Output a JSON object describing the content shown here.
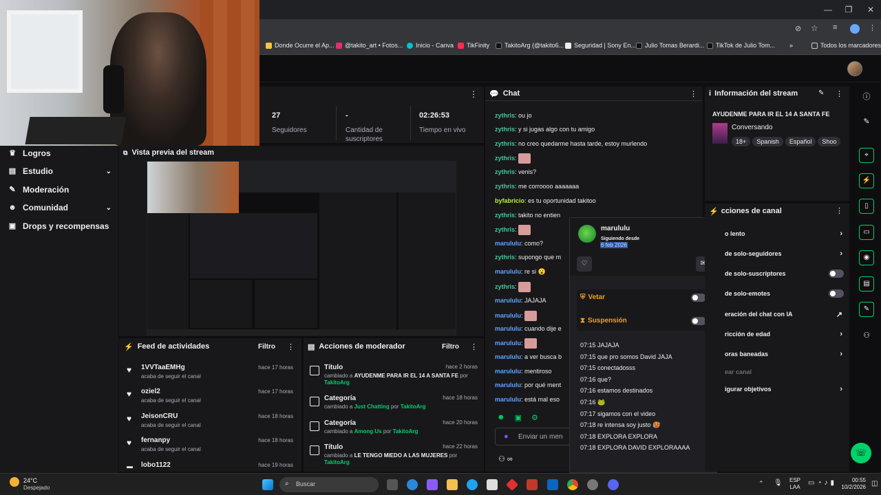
{
  "bookmarks": [
    {
      "label": "Donde Ocurre el Ap...",
      "color": "#f6c343"
    },
    {
      "label": "@takito_art • Fotos...",
      "color": "#e1306c"
    },
    {
      "label": "Inicio - Canva",
      "color": "#00c4cc"
    },
    {
      "label": "TikFinity",
      "color": "#fe2c55"
    },
    {
      "label": "TakitoArg (@takito6...",
      "color": "#000000"
    },
    {
      "label": "Seguridad | Sony En...",
      "color": "#ffffff"
    },
    {
      "label": "Julio Tomas Berardi...",
      "color": "#000000"
    },
    {
      "label": "TikTok de Julio Tom...",
      "color": "#000000"
    },
    {
      "label": "»",
      "color": ""
    },
    {
      "label": "Todos los marcadores",
      "color": ""
    }
  ],
  "leftnav": {
    "items": [
      {
        "label": "Logros",
        "icon": "trophy-icon"
      },
      {
        "label": "Estudio",
        "icon": "studio-icon"
      },
      {
        "label": "Moderación",
        "icon": "wrench-icon"
      },
      {
        "label": "Comunidad",
        "icon": "people-icon"
      },
      {
        "label": "Drops y recompensas",
        "icon": "gift-icon"
      }
    ]
  },
  "stats": {
    "followers_value": "27",
    "followers_label": "Seguidores",
    "subs_value": "-",
    "subs_label": "Cantidad de suscriptores",
    "live_value": "02:26:53",
    "live_label": "Tiempo en vivo"
  },
  "preview": {
    "title": "Vista previa del stream"
  },
  "feed": {
    "title": "Feed de actividades",
    "filter": "Filtro",
    "items": [
      {
        "name": "1VVTaaEMHg",
        "sub": "acaba de seguir el canal",
        "time": "hace 17 horas"
      },
      {
        "name": "oziel2",
        "sub": "acaba de seguir el canal",
        "time": "hace 17 horas"
      },
      {
        "name": "JeisonCRU",
        "sub": "acaba de seguir el canal",
        "time": "hace 18 horas"
      },
      {
        "name": "fernanpy",
        "sub": "acaba de seguir el canal",
        "time": "hace 18 horas"
      },
      {
        "name": "lobo1122",
        "sub": "",
        "time": "hace 19 horas"
      }
    ]
  },
  "modactions": {
    "title": "Acciones de moderador",
    "filter": "Filtro",
    "items": [
      {
        "title": "Título",
        "prefix": "cambiado a",
        "value": "AYUDENME PARA IR EL 14 A SANTA FE",
        "by": "por",
        "user": "TakitoArg",
        "time": "hace 2 horas"
      },
      {
        "title": "Categoría",
        "prefix": "cambiado a",
        "value": "Just Chatting",
        "by": "por",
        "user": "TakitoArg",
        "time": "hace 18 horas"
      },
      {
        "title": "Categoría",
        "prefix": "cambiado a",
        "value": "Among Us",
        "by": "por",
        "user": "TakitoArg",
        "time": "hace 20 horas"
      },
      {
        "title": "Título",
        "prefix": "cambiado a",
        "value": "LE TENGO MIEDO A LAS MUJERES",
        "by": "por",
        "user": "TakitoArg",
        "time": "hace 22 horas"
      }
    ]
  },
  "chat": {
    "title": "Chat",
    "placeholder": "Enviar un men",
    "messages": [
      {
        "user": "zythris",
        "text": "ou jo",
        "cls": "zy"
      },
      {
        "user": "zythris",
        "text": "y si jugas algo con tu amigo",
        "cls": "zy"
      },
      {
        "user": "zythris",
        "text": "no creo quedarme hasta tarde, estoy murlendo",
        "cls": "zy"
      },
      {
        "user": "zythris",
        "text": "",
        "cls": "zy",
        "emote": true
      },
      {
        "user": "zythris",
        "text": "venis?",
        "cls": "zy"
      },
      {
        "user": "zythris",
        "text": "me corroooo aaaaaaa",
        "cls": "zy"
      },
      {
        "user": "byfabricio",
        "text": "es tu oportunidad takitoo",
        "cls": "by"
      },
      {
        "user": "zythris",
        "text": "takito no entien",
        "cls": "zy"
      },
      {
        "user": "zythris",
        "text": "",
        "cls": "zy",
        "emote": true
      },
      {
        "user": "marululu",
        "text": "como?",
        "cls": "ma"
      },
      {
        "user": "zythris",
        "text": "supongo que m",
        "cls": "zy"
      },
      {
        "user": "marululu",
        "text": "re si 😮",
        "cls": "ma"
      },
      {
        "user": "zythris",
        "text": "",
        "cls": "zy",
        "emote": true
      },
      {
        "user": "marululu",
        "text": "JAJAJA",
        "cls": "ma"
      },
      {
        "user": "marululu",
        "text": "",
        "cls": "ma",
        "emote": true
      },
      {
        "user": "marululu",
        "text": "cuando dije e",
        "cls": "ma"
      },
      {
        "user": "marululu",
        "text": "",
        "cls": "ma",
        "emote": true
      },
      {
        "user": "marululu",
        "text": "a ver busca b",
        "cls": "ma"
      },
      {
        "user": "marululu",
        "text": "mentiroso",
        "cls": "ma"
      },
      {
        "user": "marululu",
        "text": "por qué ment",
        "cls": "ma"
      },
      {
        "user": "marululu",
        "text": "está mal eso",
        "cls": "ma"
      }
    ]
  },
  "usercard": {
    "name": "marululu",
    "following_label": "Siguiendo desde",
    "following_date": "6 feb 2026",
    "veto_label": "Vetar",
    "suspend_label": "Suspensión",
    "log": [
      "07:15 JAJAJA",
      "07:15 que pro somos David JAJA",
      "07:15 conectadosss",
      "07:16 que?",
      "07:16 estamos destinados",
      "07:16 🐸",
      "07:17 sigamos con el video",
      "07:18 re intensa soy justo 🥵",
      "07:18 EXPLORA EXPLORA",
      "07:18 EXPLORA DAVID EXPLORAAAA"
    ]
  },
  "streaminfo": {
    "title": "Información del stream",
    "stream_title": "AYUDENME PARA IR EL 14 A SANTA FE",
    "category": "Conversando",
    "tags": [
      "18+",
      "Spanish",
      "Español",
      "Shoo"
    ]
  },
  "actions": {
    "title": "cciones de canal",
    "rows": [
      {
        "label": "o lento",
        "kind": "chev"
      },
      {
        "label": "de solo-seguidores",
        "kind": "chev"
      },
      {
        "label": "de solo-suscriptores",
        "kind": "toggle"
      },
      {
        "label": "de solo-emotes",
        "kind": "toggle"
      },
      {
        "label": "eración del chat con IA",
        "kind": "ext"
      },
      {
        "label": "ricción de edad",
        "kind": "chev"
      },
      {
        "label": "oras baneadas",
        "kind": "chev"
      },
      {
        "label": "ear canal",
        "kind": "none"
      },
      {
        "label": "igurar objetivos",
        "kind": "chev"
      }
    ]
  },
  "taskbar": {
    "weather_temp": "24°C",
    "weather_desc": "Despejado",
    "search_placeholder": "Buscar",
    "lang1": "ESP",
    "lang2": "LAA",
    "time": "00:55",
    "date": "10/2/2026"
  },
  "colors": {
    "accent": "#00d26a",
    "twitch_purple": "#9147ff",
    "bg": "#0e0e10",
    "panel": "#18181b"
  }
}
